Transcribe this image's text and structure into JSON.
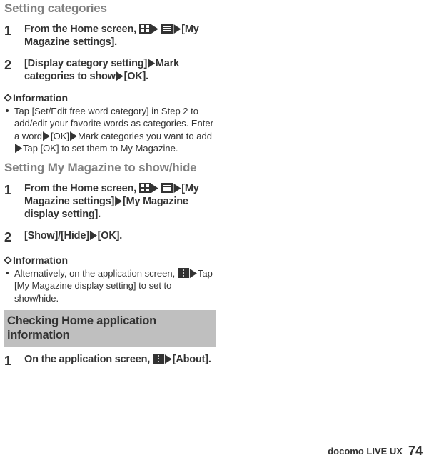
{
  "section1": {
    "title": "Setting categories",
    "step1": {
      "num": "1",
      "pre": "From the Home screen, ",
      "tail": "[My Magazine settings]."
    },
    "step2": {
      "num": "2",
      "open": "[",
      "a": "Display category setting]",
      "b": "Mark categories to show",
      "c": "[OK]."
    },
    "info_head": "Information",
    "info_body": "Tap [Set/Edit free word category] in Step 2 to add/edit your favorite words as categories. Enter a word",
    "info_body2": "[OK]",
    "info_body3": "Mark categories you want to add",
    "info_body4": "Tap [OK] to set them to My Magazine."
  },
  "section2": {
    "title": "Setting My Magazine to show/hide",
    "step1": {
      "num": "1",
      "pre": "From the Home screen, ",
      "mid": "[My Magazine settings]",
      "tail": "[My Magazine display setting]."
    },
    "step2": {
      "num": "2",
      "a": "[Show]/[Hide]",
      "b": "[OK]."
    },
    "info_head": "Information",
    "info_pre": "Alternatively, on the application screen, ",
    "info_post": "Tap [My Magazine display setting] to set to show/hide."
  },
  "block": {
    "title": "Checking Home application information",
    "step1": {
      "num": "1",
      "pre": "On the application screen, ",
      "tail": "[About]."
    }
  },
  "footer": {
    "label": "docomo LIVE UX",
    "page": "74"
  }
}
